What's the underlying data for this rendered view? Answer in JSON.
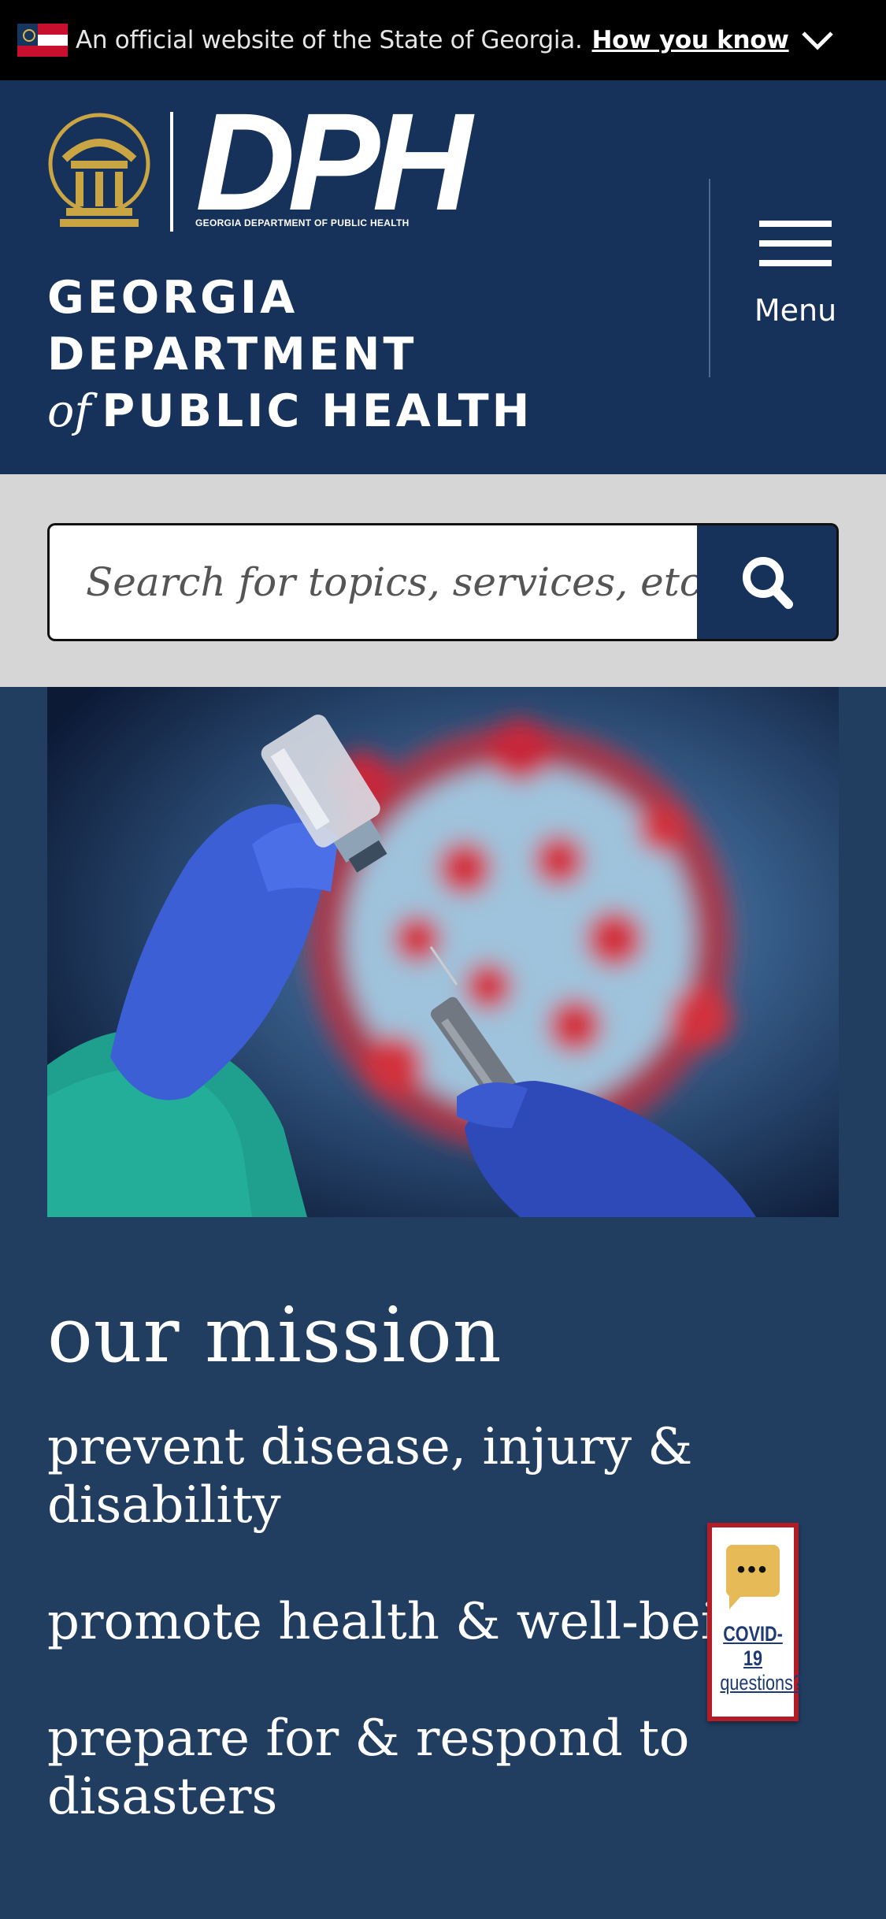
{
  "banner": {
    "text": "An official website of the State of Georgia.",
    "link_label": "How you know"
  },
  "header": {
    "logo_text": "DPH",
    "logo_subtitle": "GEORGIA DEPARTMENT OF PUBLIC HEALTH",
    "org_line1": "GEORGIA",
    "org_line2": "DEPARTMENT",
    "org_of": "of",
    "org_line3": "PUBLIC HEALTH",
    "menu_label": "Menu"
  },
  "search": {
    "placeholder": "Search for topics, services, etc..."
  },
  "mission": {
    "heading": "our mission",
    "items": [
      {
        "line1": "prevent disease, injury &",
        "line2": "disability"
      },
      {
        "line1": "promote health & well-being",
        "line2": ""
      },
      {
        "line1": "prepare for & respond to",
        "line2": "disasters"
      }
    ]
  },
  "covid_widget": {
    "line1": "COVID-19",
    "line2": "questions?"
  },
  "colors": {
    "header_bg": "#16325a",
    "page_bg": "#213e61",
    "search_band": "#d6d6d6",
    "seal_gold": "#c9a544",
    "widget_border": "#b11c26"
  }
}
